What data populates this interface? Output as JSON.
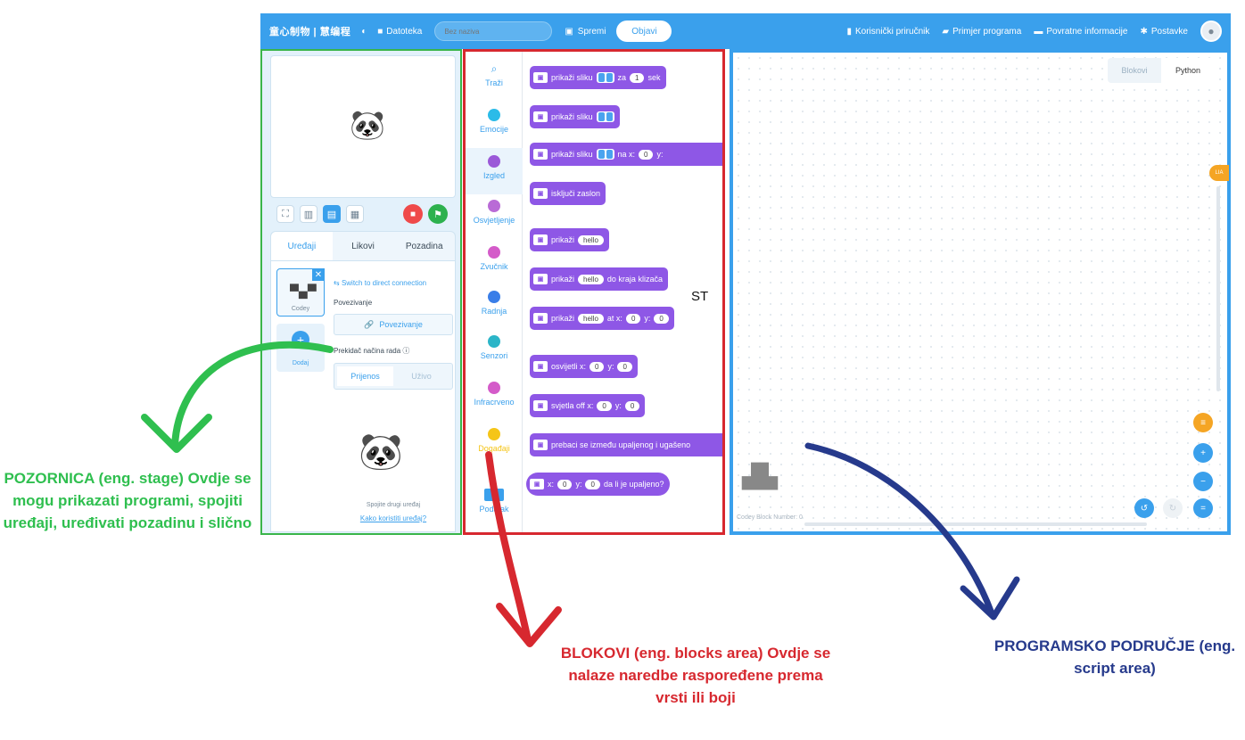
{
  "topbar": {
    "brand": "童心制物 | 慧编程",
    "file_label": "Datoteka",
    "title_placeholder": "Bez naziva",
    "save_label": "Spremi",
    "publish_label": "Objavi",
    "manual_label": "Korisnički priručnik",
    "examples_label": "Primjer programa",
    "feedback_label": "Povratne informacije",
    "settings_label": "Postavke"
  },
  "stage": {
    "tabs": [
      "Uređaji",
      "Likovi",
      "Pozadina"
    ],
    "device_name": "Codey",
    "add_label": "Dodaj",
    "switch_text": "Switch to direct connection",
    "connect_section": "Povezivanje",
    "connect_button": "Povezivanje",
    "mode_label": "Prekidač načina rada",
    "mode_options": [
      "Prijenos",
      "Uživo"
    ],
    "hint_text": "Spojite drugi uređaj",
    "hint_link": "Kako koristiti uređaj?"
  },
  "categories": [
    {
      "label": "Traži",
      "color": "#3aa0ec"
    },
    {
      "label": "Emocije",
      "color": "#2bbbe8"
    },
    {
      "label": "Izgled",
      "color": "#9b59d8"
    },
    {
      "label": "Osvjetljenje",
      "color": "#b96bd6"
    },
    {
      "label": "Zvučnik",
      "color": "#d45bc9"
    },
    {
      "label": "Radnja",
      "color": "#3a7ee8"
    },
    {
      "label": "Senzori",
      "color": "#2bb5c8"
    },
    {
      "label": "Infracrveno",
      "color": "#d45bc9"
    },
    {
      "label": "Događaji",
      "color": "#f5c518"
    },
    {
      "label": "Podatak",
      "color": "#3aa0ec"
    }
  ],
  "blocks": {
    "b1": {
      "text": "prikaži sliku",
      "mid": "za",
      "value": "1",
      "end": "sek"
    },
    "b2": {
      "text": "prikaži sliku"
    },
    "b3": {
      "text": "prikaži sliku",
      "x_label": "na x:",
      "x": "0",
      "y_label": "y:"
    },
    "b4": {
      "text": "isključi zaslon"
    },
    "b5": {
      "text": "prikaži",
      "value": "hello"
    },
    "b6": {
      "text": "prikaži",
      "value": "hello",
      "end": "do kraja klizača"
    },
    "b7": {
      "text": "prikaži",
      "value": "hello",
      "x_label": "at x:",
      "x": "0",
      "y_label": "y:",
      "y": "0"
    },
    "b8": {
      "text": "osvijetli x:",
      "x": "0",
      "y_label": "y:",
      "y": "0"
    },
    "b9": {
      "text": "svjetla off x:",
      "x": "0",
      "y_label": "y:",
      "y": "0"
    },
    "b10": {
      "text": "prebaci se između upaljenog i ugašeno"
    },
    "b11": {
      "x_label": "x:",
      "x": "0",
      "y_label": "y:",
      "y": "0",
      "end": "da li je upaljeno?"
    }
  },
  "st_text": "ST",
  "script": {
    "tabs": [
      "Blokovi",
      "Python"
    ],
    "sprite_caption": "Codey   Block Number: 0",
    "collapse_label": "LIA"
  },
  "annotations": {
    "stage": "POZORNICA (eng. stage) Ovdje se mogu prikazati programi, spojiti uređaji, uređivati pozadinu i slično",
    "blocks": "BLOKOVI (eng. blocks area) Ovdje se nalaze naredbe raspoređene prema vrsti ili boji",
    "script": "PROGRAMSKO PODRUČJE (eng. script area)"
  },
  "colors": {
    "topbar": "#3aa0ec",
    "looks_block": "#8e57e6",
    "stage_border": "#39b54a",
    "blocks_border": "#d7282f",
    "script_border": "#3aa0ec",
    "annotation_navy": "#263a8c"
  }
}
